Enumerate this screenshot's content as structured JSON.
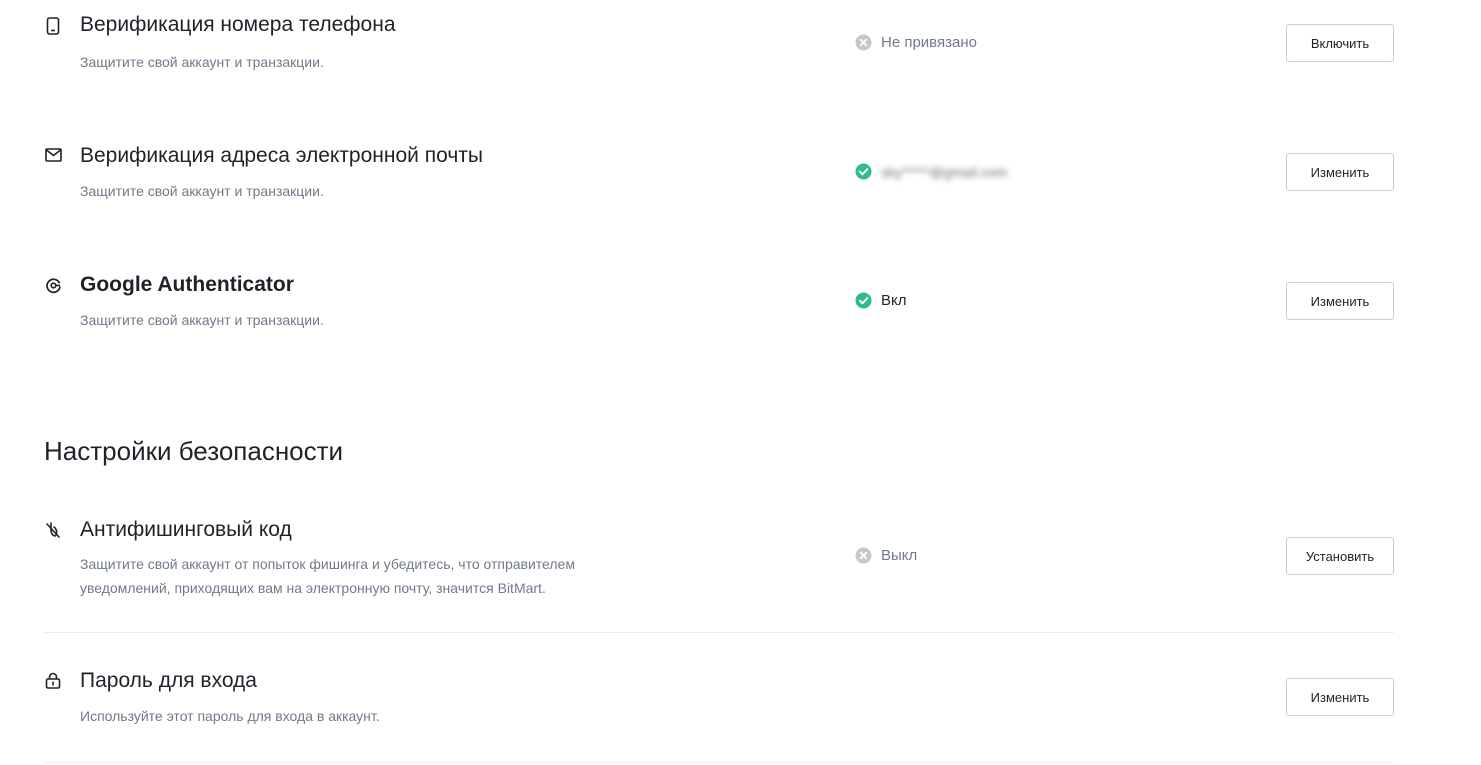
{
  "verification": {
    "phone": {
      "icon": "phone-icon",
      "title": "Верификация номера телефона",
      "description": "Защитите свой аккаунт и транзакции.",
      "status": "Не привязано",
      "status_icon": "x-circle-icon",
      "action": "Включить"
    },
    "email": {
      "icon": "mail-icon",
      "title": "Верификация адреса электронной почты",
      "description": "Защитите свой аккаунт и транзакции.",
      "status": "sky*****@gmail.com",
      "status_icon": "check-circle-icon",
      "action": "Изменить"
    },
    "google": {
      "icon": "google-authenticator-icon",
      "title": "Google Authenticator",
      "description": "Защитите свой аккаунт и транзакции.",
      "status": "Вкл",
      "status_icon": "check-circle-icon",
      "action": "Изменить"
    }
  },
  "security_settings": {
    "title": "Настройки безопасности",
    "anti_phishing": {
      "icon": "anti-phishing-icon",
      "title": "Антифишинговый код",
      "description_line1": "Защитите свой аккаунт от попыток фишинга и убедитесь, что отправителем",
      "description_line2": "уведомлений, приходящих вам на электронную почту, значится BitMart.",
      "status": "Выкл",
      "status_icon": "x-circle-icon",
      "action": "Установить"
    },
    "login_password": {
      "icon": "lock-icon",
      "title": "Пароль для входа",
      "description": "Используйте этот пароль для входа в аккаунт.",
      "action": "Изменить"
    }
  },
  "colors": {
    "success": "#2ebd85",
    "inactive": "#c4c9d0",
    "text_primary": "#1e2329",
    "text_secondary": "#707a8a",
    "border": "#c9ced6"
  }
}
